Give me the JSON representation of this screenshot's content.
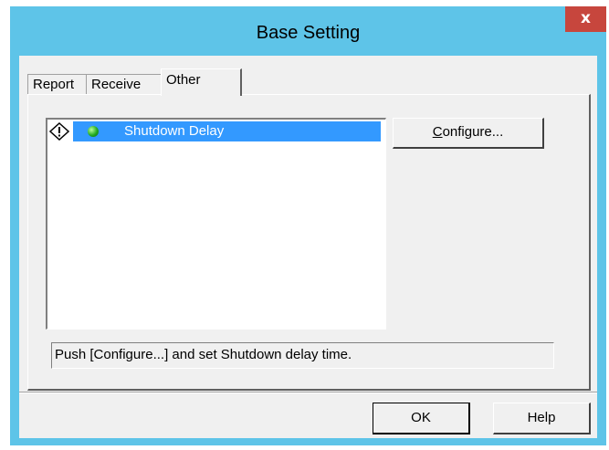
{
  "window": {
    "title": "Base Setting",
    "close_label": "x"
  },
  "tabs": [
    {
      "label": "Report"
    },
    {
      "label": "Receive"
    },
    {
      "label": "Other"
    }
  ],
  "list": {
    "items": [
      {
        "label": "Shutdown Delay",
        "status_icon": "exclamation-diamond-icon",
        "item_icon": "green-dot-icon"
      }
    ]
  },
  "buttons": {
    "configure_prefix": "C",
    "configure_rest": "onfigure...",
    "ok": "OK",
    "help": "Help"
  },
  "status_text": "Push [Configure...] and set Shutdown delay time.",
  "colors": {
    "titlebar": "#5ec4e8",
    "close": "#c7463d",
    "selection": "#3399ff",
    "face": "#f0f0f0"
  }
}
